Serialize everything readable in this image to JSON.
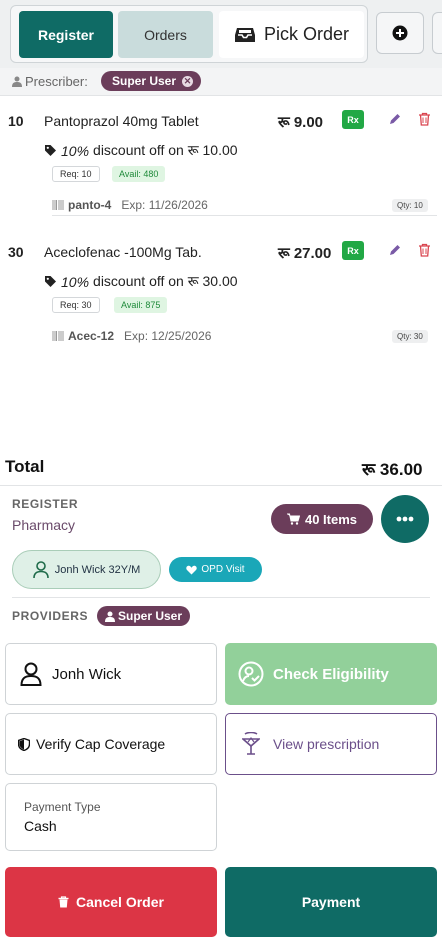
{
  "header": {
    "tabs": {
      "register": "Register",
      "orders": "Orders",
      "pick_order": "Pick Order"
    }
  },
  "prescriber": {
    "label": "Prescriber:",
    "name": "Super User"
  },
  "currency_symbol": "रू",
  "items": [
    {
      "qty": "10",
      "name": "Pantoprazol 40mg Tablet",
      "price": "रू 9.00",
      "rx": "Rx",
      "discount_pct": "10%",
      "discount_text": "discount off on रू 10.00",
      "req": "Req: 10",
      "avail": "Avail: 480",
      "sku": "panto-4",
      "exp": "Exp: 11/26/2026",
      "qty_badge": "Qty: 10"
    },
    {
      "qty": "30",
      "name": "Aceclofenac -100Mg Tab.",
      "price": "रू 27.00",
      "rx": "Rx",
      "discount_pct": "10%",
      "discount_text": "discount off on रू 30.00",
      "req": "Req: 30",
      "avail": "Avail: 875",
      "sku": "Acec-12",
      "exp": "Exp: 12/25/2026",
      "qty_badge": "Qty: 30"
    }
  ],
  "total": {
    "label": "Total",
    "value": "रू 36.00"
  },
  "register": {
    "label": "REGISTER",
    "value": "Pharmacy",
    "items_count": "40 Items"
  },
  "patient": {
    "name": "Jonh Wick 32Y/M",
    "visit": "OPD Visit"
  },
  "providers": {
    "label": "PROVIDERS",
    "name": "Super User"
  },
  "actions": {
    "user": "Jonh Wick",
    "check_eligibility": "Check Eligibility",
    "verify_cap": "Verify Cap Coverage",
    "view_prescription": "View prescription",
    "payment_type_label": "Payment Type",
    "payment_type_value": "Cash",
    "cancel": "Cancel Order",
    "payment": "Payment"
  },
  "colors": {
    "primary": "#0f6b65",
    "plum": "#6b3d5a",
    "danger": "#dc3545",
    "success_light": "#92d09a",
    "rx_green": "#22a845",
    "teal_chip": "#1aa7b8"
  }
}
